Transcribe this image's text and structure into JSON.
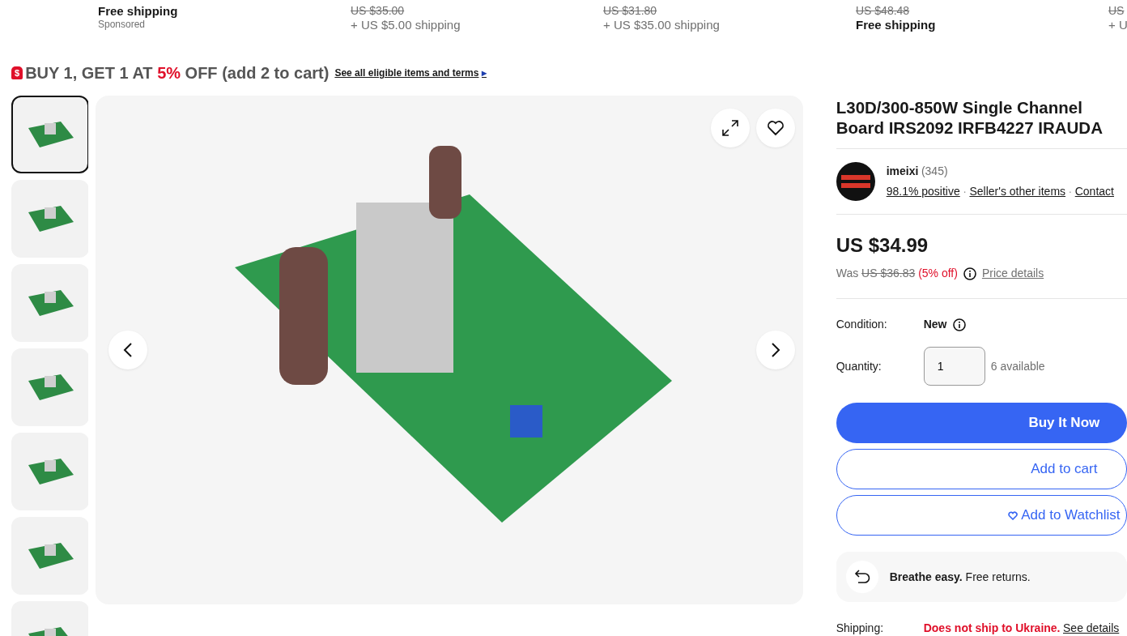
{
  "related_items": [
    {
      "lines": [
        {
          "kind": "free",
          "text": "Free shipping"
        },
        {
          "kind": "note",
          "text": "Sponsored"
        }
      ]
    },
    {
      "lines": [
        {
          "kind": "was",
          "text": "US $35.00"
        },
        {
          "kind": "shipping",
          "text": "+ US $5.00 shipping"
        }
      ]
    },
    {
      "lines": [
        {
          "kind": "was",
          "text": "US $31.80"
        },
        {
          "kind": "shipping",
          "text": "+ US $35.00 shipping"
        }
      ]
    },
    {
      "lines": [
        {
          "kind": "was",
          "text": "US $48.48"
        },
        {
          "kind": "free",
          "text": "Free shipping"
        }
      ]
    },
    {
      "lines": [
        {
          "kind": "was",
          "text": "US"
        },
        {
          "kind": "shipping",
          "text": "+ U"
        }
      ]
    }
  ],
  "promo": {
    "tag": "$",
    "prefix": "BUY 1, GET 1 AT",
    "highlight": "5%",
    "suffix": "OFF (add 2 to cart)",
    "link": "See all eligible items and terms",
    "arrow": "▸"
  },
  "thumbnails": [
    {
      "selected": true
    },
    {
      "selected": false
    },
    {
      "selected": false
    },
    {
      "selected": false
    },
    {
      "selected": false
    },
    {
      "selected": false
    },
    {
      "selected": false
    }
  ],
  "product": {
    "title_lines": [
      "L30D/300-850W Single Channel",
      "Board IRS2092 IRFB4227 IRAUDA"
    ],
    "seller": {
      "name": "imeixi",
      "count": "(345)",
      "links": [
        "98.1% positive",
        "Seller's other items",
        "Contact"
      ],
      "separator": "·"
    },
    "price": "US $34.99",
    "was_label": "Was",
    "was_price": "US $36.83",
    "discount": "(5% off)",
    "price_details": "Price details",
    "condition_label": "Condition:",
    "condition": "New",
    "quantity_label": "Quantity:",
    "quantity": "1",
    "available": "6 available",
    "buttons": [
      {
        "kind": "primary",
        "label": "Buy It Now"
      },
      {
        "kind": "outline",
        "label": "Add to cart"
      },
      {
        "kind": "watch",
        "label": "Add to Watchlist"
      }
    ],
    "returns": "**Breathe easy.** Free returns.",
    "shipping_label": "Shipping:",
    "shipping_note": "Does not ship to Ukraine.",
    "shipping_link": "See details"
  }
}
